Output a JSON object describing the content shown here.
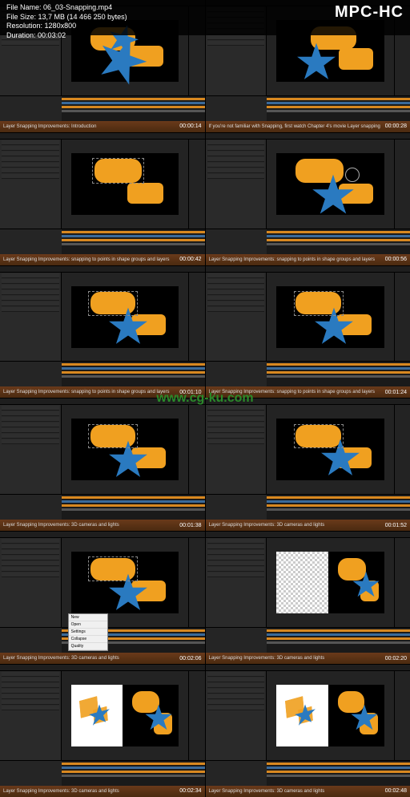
{
  "player": {
    "logo": "MPC-HC",
    "file_label": "File Name:",
    "file_name": "06_03-Snapping.mp4",
    "size_label": "File Size:",
    "file_size": "13,7 MB (14 466 250 bytes)",
    "res_label": "Resolution:",
    "resolution": "1280x800",
    "dur_label": "Duration:",
    "duration": "00:03:02"
  },
  "watermark": "www.cg-ku.com",
  "thumbnails": [
    {
      "time": "00:00:14",
      "caption": "Layer Snapping Improvements: Introduction",
      "variant": "burst"
    },
    {
      "time": "00:00:28",
      "caption": "If you're not familiar with Snapping, first watch Chapter 4's movie Layer snapping",
      "variant": "star_left"
    },
    {
      "time": "00:00:42",
      "caption": "Layer Snapping Improvements: snapping to points in shape groups and layers",
      "variant": "no_star"
    },
    {
      "time": "00:00:56",
      "caption": "Layer Snapping Improvements: snapping to points in shape groups and layers",
      "variant": "star_right_circle"
    },
    {
      "time": "00:01:10",
      "caption": "Layer Snapping Improvements: snapping to points in shape groups and layers",
      "variant": "star_mid"
    },
    {
      "time": "00:01:24",
      "caption": "Layer Snapping Improvements: snapping to points in shape groups and layers",
      "variant": "star_mid"
    },
    {
      "time": "00:01:38",
      "caption": "Layer Snapping Improvements: 3D cameras and lights",
      "variant": "star_mid"
    },
    {
      "time": "00:01:52",
      "caption": "Layer Snapping Improvements: 3D cameras and lights",
      "variant": "star_mid_tight"
    },
    {
      "time": "00:02:06",
      "caption": "Layer Snapping Improvements: 3D cameras and lights",
      "variant": "star_mid_menu"
    },
    {
      "time": "00:02:20",
      "caption": "Layer Snapping Improvements: 3D cameras and lights",
      "variant": "split_view"
    },
    {
      "time": "00:02:34",
      "caption": "Layer Snapping Improvements: 3D cameras and lights",
      "variant": "split_iso"
    },
    {
      "time": "00:02:48",
      "caption": "Layer Snapping Improvements: 3D cameras and lights",
      "variant": "split_iso"
    }
  ],
  "context_menu": [
    "New",
    "Open",
    "Settings",
    "Collapse",
    "Quality"
  ],
  "colors": {
    "orange": "#f0a020",
    "blue": "#2a7ac0",
    "bg_dark": "#232323"
  }
}
